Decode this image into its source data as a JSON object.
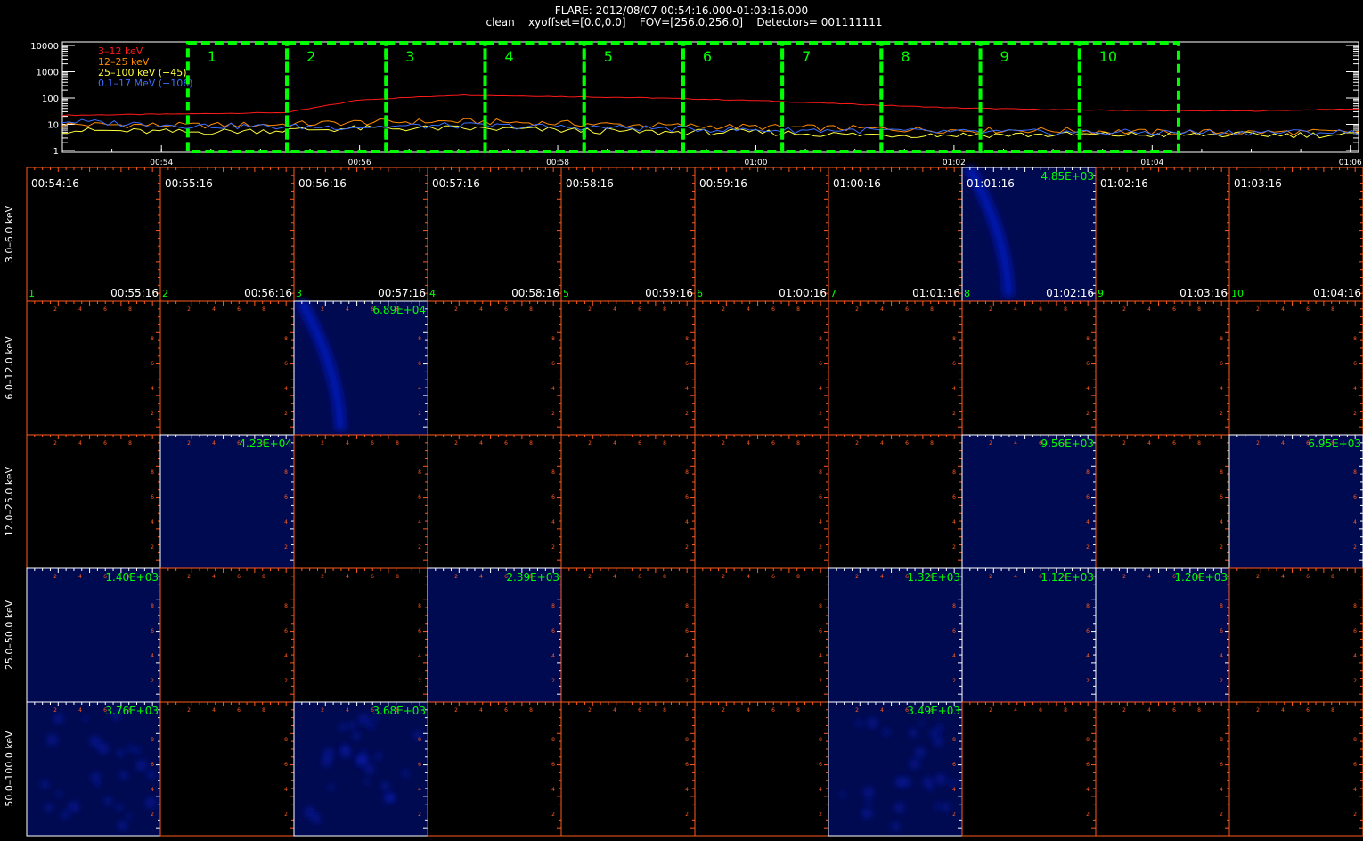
{
  "header": {
    "title": "FLARE: 2012/08/07 00:54:16.000-01:03:16.000",
    "subtitle": "clean    xyoffset=[0.0,0.0]    FOV=[256.0,256.0]    Detectors= 001111111"
  },
  "colors": {
    "background": "#000000",
    "axis_white": "#ffffff",
    "axis_orange": "#ff5a1e",
    "green": "#00ff00",
    "lc_3_12": "#ff1a1a",
    "lc_12_25": "#ff8c00",
    "lc_25_100": "#ffff3c",
    "lc_01_17": "#3c6eff",
    "image_fill": "#000a50",
    "source_blue": "#0018b0"
  },
  "chart_data": [
    {
      "type": "line",
      "name": "lightcurve",
      "ylog": true,
      "ylim": [
        1,
        10000
      ],
      "yticks": [
        "1",
        "10",
        "100",
        "1000",
        "10000"
      ],
      "xticks": [
        "00:54",
        "00:56",
        "00:58",
        "01:00",
        "01:02",
        "01:04",
        "01:06"
      ],
      "legend_position": "top-left",
      "legend": [
        "3–12 keV",
        "12–25 keV",
        "25–100 keV (−45)",
        "0.1–17 MeV (−106)"
      ],
      "interval_labels": [
        "1",
        "2",
        "3",
        "4",
        "5",
        "6",
        "7",
        "8",
        "9",
        "10"
      ],
      "series": [
        {
          "name": "3–12 keV",
          "color_key": "lc_3_12",
          "x": [
            "00:53:00",
            "00:54:16",
            "00:55:16",
            "00:56:00",
            "00:57:00",
            "00:58:00",
            "00:59:00",
            "01:00:00",
            "01:01:00",
            "01:02:00",
            "01:03:00",
            "01:04:00",
            "01:05:00",
            "01:06:00"
          ],
          "y": [
            22,
            25,
            28,
            85,
            130,
            115,
            100,
            80,
            58,
            42,
            36,
            33,
            32,
            38
          ]
        },
        {
          "name": "12–25 keV",
          "color_key": "lc_12_25",
          "x": [
            "00:53:00",
            "00:54:16",
            "00:55:16",
            "00:56:00",
            "00:57:00",
            "00:58:00",
            "00:59:00",
            "01:00:00",
            "01:01:00",
            "01:02:00",
            "01:03:00",
            "01:04:00",
            "01:05:00",
            "01:06:00"
          ],
          "y": [
            10,
            9,
            10,
            12,
            13,
            11,
            9,
            8,
            7,
            6,
            6,
            5,
            5,
            5
          ]
        },
        {
          "name": "25–100 keV (−45)",
          "color_key": "lc_25_100",
          "x": [
            "00:53:00",
            "00:54:16",
            "00:55:16",
            "00:56:00",
            "00:57:00",
            "00:58:00",
            "00:59:00",
            "01:00:00",
            "01:01:00",
            "01:02:00",
            "01:03:00",
            "01:04:00",
            "01:05:00",
            "01:06:00"
          ],
          "y": [
            6,
            5,
            6,
            7,
            7,
            6,
            5,
            5,
            4,
            4,
            4,
            4,
            4,
            4
          ]
        },
        {
          "name": "0.1–17 MeV (−106)",
          "color_key": "lc_01_17",
          "x": [
            "00:53:00",
            "00:54:16",
            "00:55:16",
            "00:56:00",
            "00:57:00",
            "00:58:00",
            "00:59:00",
            "01:00:00",
            "01:01:00",
            "01:02:00",
            "01:03:00",
            "01:04:00",
            "01:05:00",
            "01:06:00"
          ],
          "y": [
            13,
            9,
            8,
            8,
            9,
            8,
            7,
            6,
            6,
            5,
            5,
            5,
            5,
            5
          ]
        }
      ]
    },
    {
      "type": "heatmap",
      "name": "image_grid",
      "energy_bands": [
        "3.0–6.0 keV",
        "6.0–12.0 keV",
        "12.0–25.0 keV",
        "25.0–50.0 keV",
        "50.0–100.0 keV"
      ],
      "start_times": [
        "00:54:16",
        "00:55:16",
        "00:56:16",
        "00:57:16",
        "00:58:16",
        "00:59:16",
        "01:00:16",
        "01:01:16",
        "01:02:16",
        "01:03:16"
      ],
      "end_times": [
        "00:55:16",
        "00:56:16",
        "00:57:16",
        "00:58:16",
        "00:59:16",
        "01:00:16",
        "01:01:16",
        "01:02:16",
        "01:03:16",
        "01:04:16"
      ],
      "interval_numbers": [
        "1",
        "2",
        "3",
        "4",
        "5",
        "6",
        "7",
        "8",
        "9",
        "10"
      ],
      "axis_ticks": [
        "2",
        "4",
        "6",
        "8"
      ],
      "peak_labels": [
        [
          "",
          "",
          "",
          "",
          "",
          "",
          "",
          "4.85E+03",
          "",
          ""
        ],
        [
          "",
          "",
          "6.89E+04",
          "",
          "",
          "",
          "",
          "",
          "",
          ""
        ],
        [
          "",
          "4.23E+04",
          "",
          "",
          "",
          "",
          "",
          "9.56E+03",
          "",
          "6.95E+03"
        ],
        [
          "1.40E+03",
          "",
          "",
          "2.39E+03",
          "",
          "",
          "1.32E+03",
          "1.12E+03",
          "1.20E+03",
          ""
        ],
        [
          "3.76E+03",
          "",
          "3.68E+03",
          "",
          "",
          "",
          "3.49E+03",
          "",
          "",
          ""
        ]
      ],
      "source_cells": [
        [
          0,
          7
        ],
        [
          1,
          2
        ]
      ],
      "noise_cells": [
        [
          4,
          0
        ],
        [
          4,
          2
        ],
        [
          4,
          6
        ]
      ]
    }
  ]
}
